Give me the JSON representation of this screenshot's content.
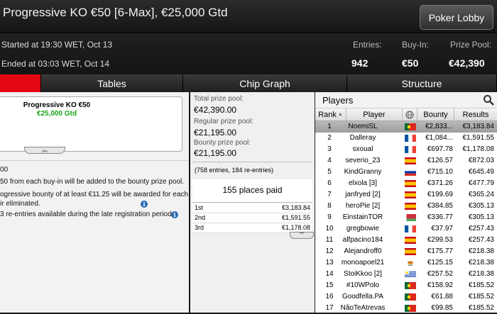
{
  "window": {
    "title": "Progressive KO €50 [6-Max], €25,000 Gtd",
    "lobby_button": "Poker Lobby"
  },
  "info": {
    "started": "Started at 19:30 WET, Oct 13",
    "ended": "Ended at 03:03 WET, Oct 14",
    "entries_label": "Entries:",
    "entries": "942",
    "buyin_label": "Buy-In:",
    "buyin": "€50",
    "prizepool_label": "Prize Pool:",
    "prizepool": "€42,390"
  },
  "tabs": [
    {
      "label": "Tables"
    },
    {
      "label": "Chip Graph"
    },
    {
      "label": "Structure"
    }
  ],
  "tourney_card": {
    "name": "Progressive KO €50",
    "gtd": "€25,000 Gtd"
  },
  "rules": [
    "00",
    "50 from each buy-in will be added to the bounty prize pool.",
    "ogressive bounty of at least €11.25 will be awarded for each",
    "ir eliminated.",
    "3 re-entries available during the late registration period."
  ],
  "prize_pool": {
    "total_label": "Total prize pool:",
    "total": "€42,390.00",
    "regular_label": "Regular prize pool:",
    "regular": "€21,195.00",
    "bounty_label": "Bounty prize pool:",
    "bounty": "€21,195.00",
    "entries_note": "(758 entries, 184 re-entries)",
    "places_paid": "155 places paid",
    "payouts": [
      {
        "place": "1st",
        "amount": "€3,183.84"
      },
      {
        "place": "2nd",
        "amount": "€1,591.55"
      },
      {
        "place": "3rd",
        "amount": "€1,178.08"
      }
    ]
  },
  "players_panel": {
    "title": "Players",
    "columns": {
      "rank": "Rank",
      "sort_arrow": "▲",
      "player": "Player",
      "bounty": "Bounty",
      "results": "Results"
    },
    "rows": [
      {
        "rank": "1",
        "player": "NoemiSL",
        "flag": "pt",
        "bounty": "€2,833...",
        "results": "€3,183.84",
        "selected": true
      },
      {
        "rank": "2",
        "player": "Dalleray",
        "flag": "fr",
        "bounty": "€1,084...",
        "results": "€1,591.55"
      },
      {
        "rank": "3",
        "player": "sxoual",
        "flag": "fr",
        "bounty": "€697.78",
        "results": "€1,178.08"
      },
      {
        "rank": "4",
        "player": "severio_23",
        "flag": "es",
        "bounty": "€126.57",
        "results": "€872.03"
      },
      {
        "rank": "5",
        "player": "KindGranny",
        "flag": "ru",
        "bounty": "€715.10",
        "results": "€645.49"
      },
      {
        "rank": "6",
        "player": "elxola [3]",
        "flag": "es",
        "bounty": "€371.26",
        "results": "€477.79"
      },
      {
        "rank": "7",
        "player": "janfryed [2]",
        "flag": "es",
        "bounty": "€199.69",
        "results": "€365.24"
      },
      {
        "rank": "8",
        "player": "heroPie [2]",
        "flag": "es",
        "bounty": "€384.85",
        "results": "€305.13"
      },
      {
        "rank": "9",
        "player": "EinstainTOR",
        "flag": "by",
        "bounty": "€336.77",
        "results": "€305.13"
      },
      {
        "rank": "10",
        "player": "gregbowie",
        "flag": "fr",
        "bounty": "€37.97",
        "results": "€257.43"
      },
      {
        "rank": "11",
        "player": "alfpacino184",
        "flag": "es",
        "bounty": "€299.53",
        "results": "€257.43"
      },
      {
        "rank": "12",
        "player": "Alejandroff0",
        "flag": "es",
        "bounty": "€175.77",
        "results": "€218.38"
      },
      {
        "rank": "13",
        "player": "monoapoel21",
        "flag": "cy",
        "bounty": "€125.15",
        "results": "€218.38"
      },
      {
        "rank": "14",
        "player": "StoiKkoo [2]",
        "flag": "uy",
        "bounty": "€257.52",
        "results": "€218.38"
      },
      {
        "rank": "15",
        "player": "#10WPolo",
        "flag": "pt",
        "bounty": "€158.92",
        "results": "€185.52"
      },
      {
        "rank": "16",
        "player": "Goodfella.PA",
        "flag": "pt",
        "bounty": "€61.88",
        "results": "€185.52"
      },
      {
        "rank": "17",
        "player": "NãoTeAtrevas",
        "flag": "pt",
        "bounty": "€99.85",
        "results": "€185.52"
      }
    ]
  },
  "colors": {
    "accent_red": "#e30613",
    "gtd_green": "#19a319",
    "info_blue": "#2a6bb3"
  }
}
